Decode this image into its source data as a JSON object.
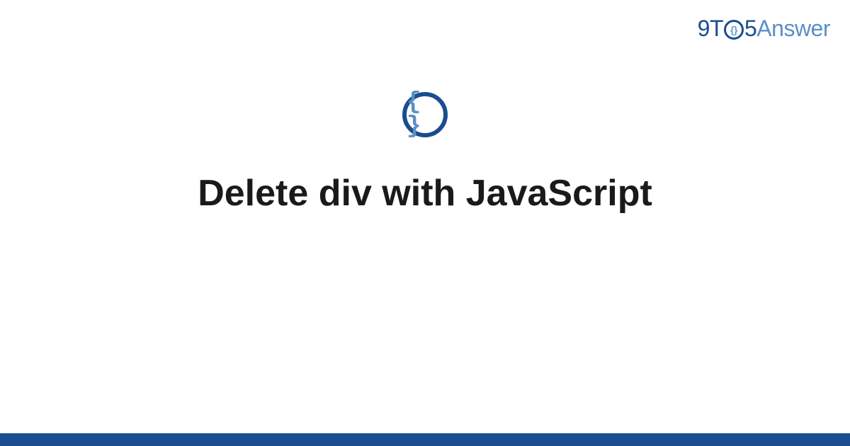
{
  "logo": {
    "part1": "9T",
    "o_inner": "{}",
    "part2": "5",
    "part3": "Answer"
  },
  "center_icon": {
    "symbol": "{ }"
  },
  "title": "Delete div with JavaScript",
  "colors": {
    "primary": "#1a4d8f",
    "secondary": "#5b8fc7",
    "text": "#1a1a1a"
  }
}
